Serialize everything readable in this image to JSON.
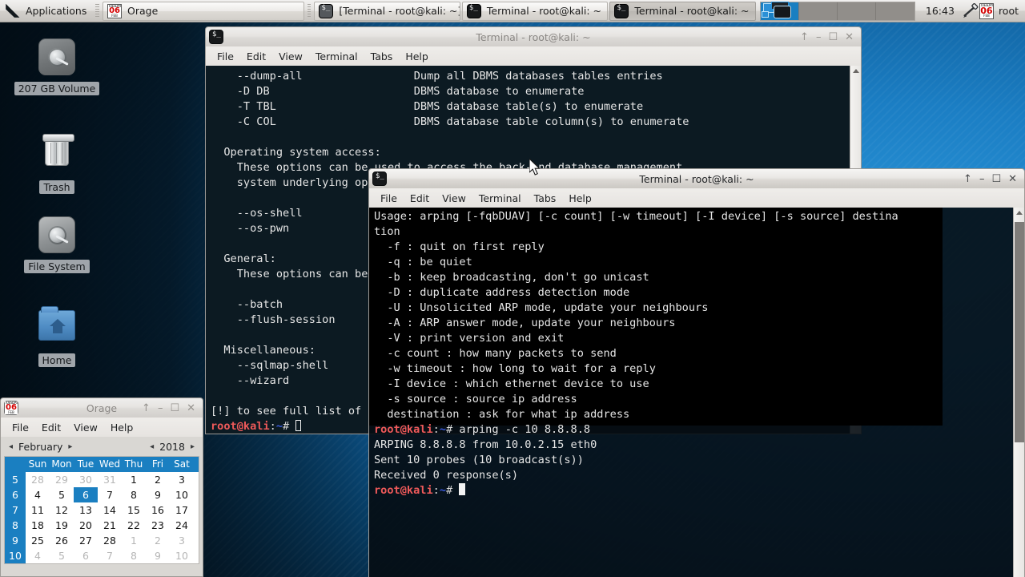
{
  "panel": {
    "applications_label": "Applications",
    "tasks": [
      {
        "label": "Orage",
        "icon": "orage-calendar-icon",
        "active": false
      },
      {
        "label": "[Terminal - root@kali: ~]",
        "icon": "terminal-icon",
        "active": false
      },
      {
        "label": "Terminal - root@kali: ~",
        "icon": "terminal-icon",
        "active": false
      },
      {
        "label": "Terminal - root@kali: ~",
        "icon": "terminal-icon",
        "active": true
      }
    ],
    "workspaces": [
      {
        "name": "workspace-1",
        "active": true
      },
      {
        "name": "workspace-2",
        "active": false
      },
      {
        "name": "workspace-3",
        "active": false
      },
      {
        "name": "workspace-4",
        "active": false
      }
    ],
    "clock": "16:43",
    "tray_plug_icon": "network-plug-icon",
    "tray_date_icon": {
      "weekday": "TUESDAY",
      "day": "06",
      "month": "FEB"
    },
    "user": "root"
  },
  "desktop_icons": [
    {
      "label": "207 GB Volume",
      "icon": "harddisk-icon"
    },
    {
      "label": "Trash",
      "icon": "trash-icon"
    },
    {
      "label": "File System",
      "icon": "harddisk-icon"
    },
    {
      "label": "Home",
      "icon": "home-folder-icon"
    }
  ],
  "back_terminal": {
    "title": "Terminal - root@kali: ~",
    "menu": [
      "File",
      "Edit",
      "View",
      "Terminal",
      "Tabs",
      "Help"
    ],
    "buttons": {
      "shade": "↑",
      "minimize": "–",
      "maximize": "☐",
      "close": "✕"
    },
    "lines": [
      "    --dump-all                 Dump all DBMS databases tables entries",
      "    -D DB                      DBMS database to enumerate",
      "    -T TBL                     DBMS database table(s) to enumerate",
      "    -C COL                     DBMS database table column(s) to enumerate",
      "",
      "  Operating system access:",
      "    These options can be used to access the back-end database management",
      "    system underlying operating system",
      "",
      "    --os-shell                 Prompt for an interactive operating system shell",
      "    --os-pwn                   Prompt for an OOB shell, Meterpreter or VNC",
      "",
      "  General:",
      "    These options can be used to set some general working parameters",
      "",
      "    --batch                    Never ask for user input, use the default behaviour",
      "    --flush-session            Flush session files for current target",
      "",
      "  Miscellaneous:",
      "    --sqlmap-shell             Prompt for an interactive sqlmap shell",
      "    --wizard                   Simple wizard interface for beginner users",
      "",
      "[!] to see full list of options run with '-hh'"
    ],
    "prompt": {
      "user_host": "root@kali",
      "colon": ":",
      "path": "~",
      "sigil": "# "
    }
  },
  "front_terminal": {
    "title": "Terminal - root@kali: ~",
    "menu": [
      "File",
      "Edit",
      "View",
      "Terminal",
      "Tabs",
      "Help"
    ],
    "buttons": {
      "shade": "↑",
      "minimize": "–",
      "maximize": "☐",
      "close": "✕"
    },
    "lines": [
      "Usage: arping [-fqbDUAV] [-c count] [-w timeout] [-I device] [-s source] destina",
      "tion",
      "  -f : quit on first reply",
      "  -q : be quiet",
      "  -b : keep broadcasting, don't go unicast",
      "  -D : duplicate address detection mode",
      "  -U : Unsolicited ARP mode, update your neighbours",
      "  -A : ARP answer mode, update your neighbours",
      "  -V : print version and exit",
      "  -c count : how many packets to send",
      "  -w timeout : how long to wait for a reply",
      "  -I device : which ethernet device to use",
      "  -s source : source ip address",
      "  destination : ask for what ip address"
    ],
    "command_prompt": {
      "user_host": "root@kali",
      "colon": ":",
      "path": "~",
      "sigil": "# "
    },
    "command": "arping -c 10 8.8.8.8",
    "output": [
      "ARPING 8.8.8.8 from 10.0.2.15 eth0",
      "Sent 10 probes (10 broadcast(s))",
      "Received 0 response(s)"
    ]
  },
  "orage": {
    "title": "Orage",
    "menu": [
      "File",
      "Edit",
      "View",
      "Help"
    ],
    "buttons": {
      "shade": "↑",
      "minimize": "–",
      "maximize": "☐",
      "close": "✕"
    },
    "month": "February",
    "year": "2018",
    "prev_arrow": "◂",
    "next_arrow": "▸",
    "weekday_headers": [
      "Sun",
      "Mon",
      "Tue",
      "Wed",
      "Thu",
      "Fri",
      "Sat"
    ],
    "week_numbers": [
      "5",
      "6",
      "7",
      "8",
      "9",
      "10"
    ],
    "weeks": [
      [
        {
          "d": "28",
          "o": true
        },
        {
          "d": "29",
          "o": true
        },
        {
          "d": "30",
          "o": true
        },
        {
          "d": "31",
          "o": true
        },
        {
          "d": "1",
          "o": false
        },
        {
          "d": "2",
          "o": false
        },
        {
          "d": "3",
          "o": false
        }
      ],
      [
        {
          "d": "4",
          "o": false
        },
        {
          "d": "5",
          "o": false
        },
        {
          "d": "6",
          "o": false,
          "today": true
        },
        {
          "d": "7",
          "o": false
        },
        {
          "d": "8",
          "o": false
        },
        {
          "d": "9",
          "o": false
        },
        {
          "d": "10",
          "o": false
        }
      ],
      [
        {
          "d": "11",
          "o": false
        },
        {
          "d": "12",
          "o": false
        },
        {
          "d": "13",
          "o": false
        },
        {
          "d": "14",
          "o": false
        },
        {
          "d": "15",
          "o": false
        },
        {
          "d": "16",
          "o": false
        },
        {
          "d": "17",
          "o": false
        }
      ],
      [
        {
          "d": "18",
          "o": false
        },
        {
          "d": "19",
          "o": false
        },
        {
          "d": "20",
          "o": false
        },
        {
          "d": "21",
          "o": false
        },
        {
          "d": "22",
          "o": false
        },
        {
          "d": "23",
          "o": false
        },
        {
          "d": "24",
          "o": false
        }
      ],
      [
        {
          "d": "25",
          "o": false
        },
        {
          "d": "26",
          "o": false
        },
        {
          "d": "27",
          "o": false
        },
        {
          "d": "28",
          "o": false
        },
        {
          "d": "1",
          "o": true
        },
        {
          "d": "2",
          "o": true
        },
        {
          "d": "3",
          "o": true
        }
      ],
      [
        {
          "d": "4",
          "o": true
        },
        {
          "d": "5",
          "o": true
        },
        {
          "d": "6",
          "o": true
        },
        {
          "d": "7",
          "o": true
        },
        {
          "d": "8",
          "o": true
        },
        {
          "d": "9",
          "o": true
        },
        {
          "d": "10",
          "o": true
        }
      ]
    ]
  },
  "colors": {
    "accent_blue": "#1a7fc1",
    "panel_bg": "#dedbd6",
    "terminal_fg": "#e6e6e6",
    "prompt_red": "#ef5a5a",
    "prompt_blue": "#3b5bdd",
    "wallpaper_blue": "#1b7ec4"
  }
}
